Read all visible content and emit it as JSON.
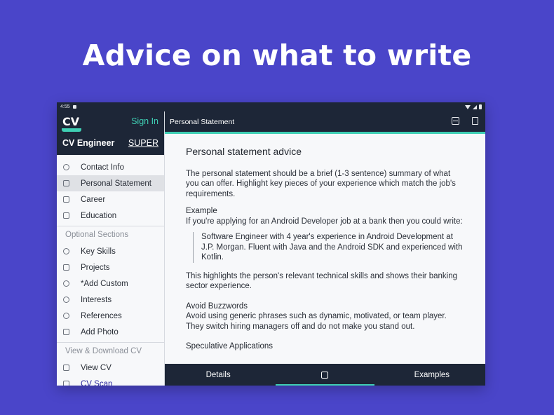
{
  "headline": "Advice on what to write",
  "status_bar": {
    "time": "4:55"
  },
  "sidebar": {
    "logo": "CV",
    "sign_in": "Sign In",
    "app_name": "CV Engineer",
    "super_label": "SUPER",
    "main_items": [
      {
        "label": "Contact Info",
        "icon": "phone-icon"
      },
      {
        "label": "Personal Statement",
        "icon": "person-card-icon"
      },
      {
        "label": "Career",
        "icon": "briefcase-icon"
      },
      {
        "label": "Education",
        "icon": "book-icon"
      }
    ],
    "optional_title": "Optional Sections",
    "optional_items": [
      {
        "label": "Key Skills",
        "icon": "key-icon"
      },
      {
        "label": "Projects",
        "icon": "clipboard-icon"
      },
      {
        "label": "*Add Custom",
        "icon": "plus-circle-icon"
      },
      {
        "label": "Interests",
        "icon": "heart-icon"
      },
      {
        "label": "References",
        "icon": "people-icon"
      },
      {
        "label": "Add Photo",
        "icon": "photo-icon"
      }
    ],
    "view_title": "View & Download CV",
    "view_items": [
      {
        "label": "View CV",
        "icon": "document-icon"
      },
      {
        "label": "CV Scan",
        "icon": "scan-icon"
      }
    ]
  },
  "topbar": {
    "title": "Personal Statement"
  },
  "content": {
    "heading": "Personal statement advice",
    "intro": "The personal statement should be a brief (1-3 sentence) summary of what you can offer. Highlight key pieces of your experience which match the job's requirements.",
    "example_title": "Example",
    "example_text": "If you're applying for an Android Developer job at a bank then you could write:",
    "quote": "Software Engineer with 4 year's experience in Android Development at J.P. Morgan. Fluent with Java and the Android SDK and experienced with Kotlin.",
    "highlight": "This highlights the person's relevant technical skills and shows their banking sector experience.",
    "buzz_title": "Avoid Buzzwords",
    "buzz_text": "Avoid using generic phrases such as dynamic, motivated, or team player. They switch hiring managers off and do not make you stand out.",
    "spec_title": "Speculative Applications"
  },
  "bottom_nav": {
    "details": "Details",
    "examples": "Examples"
  },
  "colors": {
    "background": "#4a45c9",
    "dark": "#1d2637",
    "accent": "#3fcfb4"
  }
}
